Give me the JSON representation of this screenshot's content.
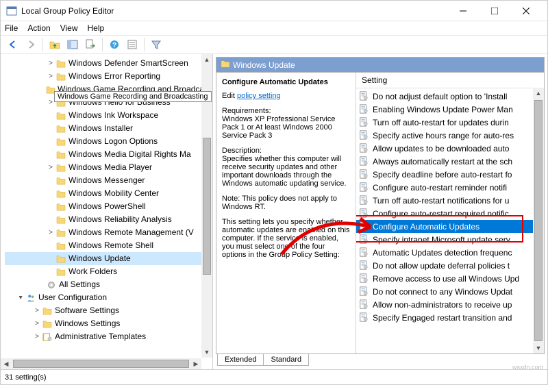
{
  "window": {
    "title": "Local Group Policy Editor"
  },
  "menu": [
    "File",
    "Action",
    "View",
    "Help"
  ],
  "tree": {
    "items": [
      {
        "label": "Windows Defender SmartScreen",
        "chev": ">",
        "indent": 1
      },
      {
        "label": "Windows Error Reporting",
        "chev": ">",
        "indent": 1
      },
      {
        "label": "Windows Game Recording and Broadcasting",
        "chev": "",
        "indent": 1
      },
      {
        "label": "Windows Hello for Business",
        "chev": ">",
        "indent": 1
      },
      {
        "label": "Windows Ink Workspace",
        "chev": "",
        "indent": 1
      },
      {
        "label": "Windows Installer",
        "chev": "",
        "indent": 1
      },
      {
        "label": "Windows Logon Options",
        "chev": "",
        "indent": 1
      },
      {
        "label": "Windows Media Digital Rights Ma",
        "chev": "",
        "indent": 1
      },
      {
        "label": "Windows Media Player",
        "chev": ">",
        "indent": 1
      },
      {
        "label": "Windows Messenger",
        "chev": "",
        "indent": 1
      },
      {
        "label": "Windows Mobility Center",
        "chev": "",
        "indent": 1
      },
      {
        "label": "Windows PowerShell",
        "chev": "",
        "indent": 1
      },
      {
        "label": "Windows Reliability Analysis",
        "chev": "",
        "indent": 1
      },
      {
        "label": "Windows Remote Management (V",
        "chev": ">",
        "indent": 1
      },
      {
        "label": "Windows Remote Shell",
        "chev": "",
        "indent": 1
      },
      {
        "label": "Windows Update",
        "chev": "",
        "indent": 1,
        "sel": true
      },
      {
        "label": "Work Folders",
        "chev": "",
        "indent": 1
      }
    ],
    "all_settings": "All Settings",
    "user_config": "User Configuration",
    "software": "Software Settings",
    "windows_settings": "Windows Settings",
    "admin": "Administrative Templates"
  },
  "tooltip": "Windows Game Recording and Broadcasting",
  "header": "Windows Update",
  "desc": {
    "title": "Configure Automatic Updates",
    "edit_label": "Edit",
    "edit_link": "policy setting",
    "req_label": "Requirements:",
    "req_text": "Windows XP Professional Service Pack 1 or At least Windows 2000 Service Pack 3",
    "description_label": "Description:",
    "description_text": "Specifies whether this computer will receive security updates and other important downloads through the Windows automatic updating service.",
    "note": "Note: This policy does not apply to Windows RT.",
    "more": "This setting lets you specify whether automatic updates are enabled on this computer. If the service is enabled, you must select one of the four options in the Group Policy Setting:"
  },
  "settings": {
    "column": "Setting",
    "items": [
      "Do not adjust default option to 'Install",
      "Enabling Windows Update Power Man",
      "Turn off auto-restart for updates durin",
      "Specify active hours range for auto-res",
      "Allow updates to be downloaded auto",
      "Always automatically restart at the sch",
      "Specify deadline before auto-restart fo",
      "Configure auto-restart reminder notifi",
      "Turn off auto-restart notifications for u",
      "Configure auto-restart required notific",
      "Configure Automatic Updates",
      "Specify intranet Microsoft update serv",
      "Automatic Updates detection frequenc",
      "Do not allow update deferral policies t",
      "Remove access to use all Windows Upd",
      "Do not connect to any Windows Updat",
      "Allow non-administrators to receive up",
      "Specify Engaged restart transition and"
    ],
    "selected_index": 10
  },
  "tabs": {
    "extended": "Extended",
    "standard": "Standard"
  },
  "status": "31 setting(s)",
  "watermark": "wsxdn.com"
}
